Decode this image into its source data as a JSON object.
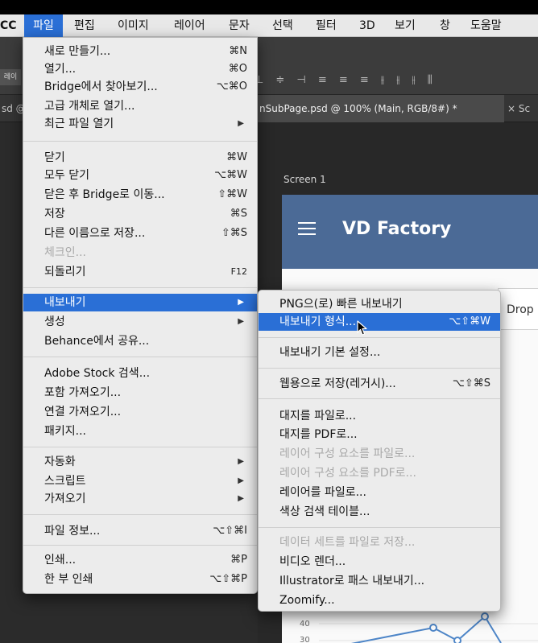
{
  "menubar": {
    "items": [
      {
        "label": "CC",
        "active": false
      },
      {
        "label": "파일",
        "active": true
      },
      {
        "label": "편집",
        "active": false
      },
      {
        "label": "이미지",
        "active": false
      },
      {
        "label": "레이어",
        "active": false
      },
      {
        "label": "문자",
        "active": false
      },
      {
        "label": "선택",
        "active": false
      },
      {
        "label": "필터",
        "active": false
      },
      {
        "label": "3D",
        "active": false
      },
      {
        "label": "보기",
        "active": false
      },
      {
        "label": "창",
        "active": false
      },
      {
        "label": "도움말",
        "active": false
      }
    ]
  },
  "options_bar": {
    "left_label": "레이"
  },
  "tabs": [
    {
      "label": "sd @"
    },
    {
      "label": "nSubPage.psd @ 100% (Main, RGB/8#) *"
    },
    {
      "label": "× Sc"
    }
  ],
  "canvas": {
    "screen_label": "Screen 1",
    "app_title": "VD Factory",
    "drop_text": "Drop",
    "axis_ticks": [
      "40",
      "30"
    ]
  },
  "file_menu": {
    "items": [
      {
        "label": "새로 만들기...",
        "shortcut": "⌘N"
      },
      {
        "label": "열기...",
        "shortcut": "⌘O"
      },
      {
        "label": "Bridge에서 찾아보기...",
        "shortcut": "⌥⌘O"
      },
      {
        "label": "고급 개체로 열기...",
        "shortcut": ""
      },
      {
        "label": "최근 파일 열기",
        "shortcut": "",
        "submenu": true
      },
      {
        "label": "닫기",
        "shortcut": "⌘W"
      },
      {
        "label": "모두 닫기",
        "shortcut": "⌥⌘W"
      },
      {
        "label": "닫은 후 Bridge로 이동...",
        "shortcut": "⇧⌘W"
      },
      {
        "label": "저장",
        "shortcut": "⌘S"
      },
      {
        "label": "다른 이름으로 저장...",
        "shortcut": "⇧⌘S"
      },
      {
        "label": "체크인...",
        "shortcut": "",
        "disabled": true
      },
      {
        "label": "되돌리기",
        "shortcut": "F12"
      },
      {
        "label": "내보내기",
        "shortcut": "",
        "submenu": true,
        "highlighted": true
      },
      {
        "label": "생성",
        "shortcut": "",
        "submenu": true
      },
      {
        "label": "Behance에서 공유...",
        "shortcut": ""
      },
      {
        "label": "Adobe Stock 검색...",
        "shortcut": ""
      },
      {
        "label": "포함 가져오기...",
        "shortcut": ""
      },
      {
        "label": "연결 가져오기...",
        "shortcut": ""
      },
      {
        "label": "패키지...",
        "shortcut": ""
      },
      {
        "label": "자동화",
        "shortcut": "",
        "submenu": true
      },
      {
        "label": "스크립트",
        "shortcut": "",
        "submenu": true
      },
      {
        "label": "가져오기",
        "shortcut": "",
        "submenu": true
      },
      {
        "label": "파일 정보...",
        "shortcut": "⌥⇧⌘I"
      },
      {
        "label": "인쇄...",
        "shortcut": "⌘P"
      },
      {
        "label": "한 부 인쇄",
        "shortcut": "⌥⇧⌘P"
      }
    ]
  },
  "export_menu": {
    "items": [
      {
        "label": "PNG으(로) 빠른 내보내기",
        "shortcut": ""
      },
      {
        "label": "내보내기 형식...",
        "shortcut": "⌥⇧⌘W",
        "highlighted": true
      },
      {
        "label": "내보내기 기본 설정...",
        "shortcut": ""
      },
      {
        "label": "웹용으로 저장(레거시)...",
        "shortcut": "⌥⇧⌘S"
      },
      {
        "label": "대지를 파일로...",
        "shortcut": ""
      },
      {
        "label": "대지를 PDF로...",
        "shortcut": ""
      },
      {
        "label": "레이어 구성 요소를 파일로...",
        "shortcut": "",
        "disabled": true
      },
      {
        "label": "레이어 구성 요소를 PDF로...",
        "shortcut": "",
        "disabled": true
      },
      {
        "label": "레이어를 파일로...",
        "shortcut": ""
      },
      {
        "label": "색상 검색 테이블...",
        "shortcut": ""
      },
      {
        "label": "데이터 세트를 파일로 저장...",
        "shortcut": "",
        "disabled": true
      },
      {
        "label": "비디오 렌더...",
        "shortcut": ""
      },
      {
        "label": "Illustrator로 패스 내보내기...",
        "shortcut": ""
      },
      {
        "label": "Zoomify...",
        "shortcut": ""
      }
    ]
  },
  "colors": {
    "highlight": "#2a6fd6",
    "app_header": "#4b6a96",
    "menu_bg": "#ececec"
  }
}
